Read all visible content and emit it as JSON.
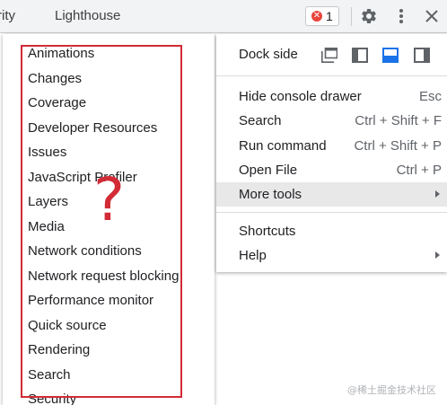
{
  "tabs": {
    "partial_tab": "rity",
    "lighthouse": "Lighthouse"
  },
  "toolbar": {
    "error_count": "1",
    "icons": [
      "error-icon",
      "gear-icon",
      "kebab-icon",
      "close-icon"
    ]
  },
  "submenu": {
    "items": [
      "Animations",
      "Changes",
      "Coverage",
      "Developer Resources",
      "Issues",
      "JavaScript Profiler",
      "Layers",
      "Media",
      "Network conditions",
      "Network request blocking",
      "Performance monitor",
      "Quick source",
      "Rendering",
      "Search",
      "Security"
    ]
  },
  "annotation": {
    "question_mark": "?"
  },
  "menu": {
    "dock_side_label": "Dock side",
    "dock_icons": [
      "undock-icon",
      "dock-left-icon",
      "dock-bottom-icon",
      "dock-right-icon"
    ],
    "selected_dock": "dock-bottom-icon",
    "items": [
      {
        "label": "Hide console drawer",
        "shortcut": "Esc"
      },
      {
        "label": "Search",
        "shortcut": "Ctrl + Shift + F"
      },
      {
        "label": "Run command",
        "shortcut": "Ctrl + Shift + P"
      },
      {
        "label": "Open File",
        "shortcut": "Ctrl + P"
      },
      {
        "label": "More tools",
        "shortcut": ""
      }
    ],
    "bottom_items": [
      {
        "label": "Shortcuts"
      },
      {
        "label": "Help"
      }
    ]
  },
  "colors": {
    "accent": "#1a73e8",
    "annotation": "#d22b36",
    "error": "#e8453c"
  },
  "watermark": "@稀土掘金技术社区"
}
